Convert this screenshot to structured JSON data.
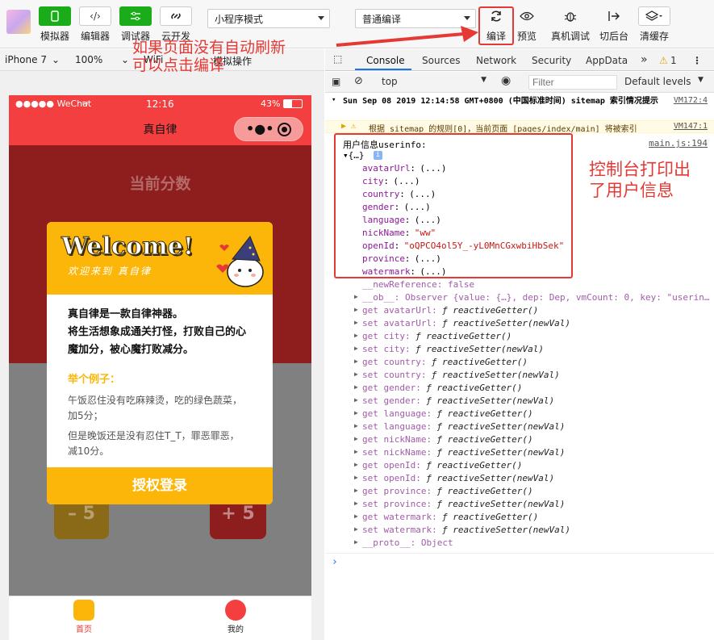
{
  "toolbar": {
    "buttons": [
      {
        "label": "模拟器",
        "icon": "phone-icon"
      },
      {
        "label": "编辑器",
        "icon": "code-icon"
      },
      {
        "label": "调试器",
        "icon": "sliders-icon"
      },
      {
        "label": "云开发",
        "icon": "cloud-link-icon"
      }
    ],
    "mode_select": "小程序模式",
    "compile_select": "普通编译",
    "right_buttons": [
      {
        "label": "编译",
        "icon": "refresh-icon"
      },
      {
        "label": "预览",
        "icon": "eye-icon"
      },
      {
        "label": "真机调试",
        "icon": "bug-icon"
      },
      {
        "label": "切后台",
        "icon": "exit-icon"
      },
      {
        "label": "清缓存",
        "icon": "layers-icon"
      }
    ]
  },
  "devbar": {
    "device": "iPhone 7",
    "zoom": "100%",
    "network": "WiFi",
    "action": "模拟操作"
  },
  "annotations": {
    "compile_hint_line1": "如果页面没有自动刷新",
    "compile_hint_line2": "可以点击编译",
    "console_hint_line1": "控制台打印出",
    "console_hint_line2": "了用户信息"
  },
  "phone": {
    "carrier": "●●●●● WeChat",
    "time": "12:16",
    "battery": "43%",
    "nav_title": "真自律",
    "score_title": "当前分数",
    "minus_label": "– 5",
    "plus_label": "+ 5",
    "tabs": [
      {
        "label": "首页"
      },
      {
        "label": "我的"
      }
    ],
    "modal": {
      "welcome": "Welcome!",
      "welcome_sub": "欢迎来到  真自律",
      "line1": "真自律是一款自律神器。",
      "line2": "将生活想象成通关打怪，打败自己的心魔加分，被心魔打败减分。",
      "example_title": "举个例子：",
      "example1": "午饭忍住没有吃麻辣烫，吃的绿色蔬菜，加5分；",
      "example2": "但是晚饭还是没有忍住T_T，罪恶罪恶，减10分。",
      "auth_button": "授权登录"
    }
  },
  "devtools": {
    "tabs": [
      "Console",
      "Sources",
      "Network",
      "Security",
      "AppData"
    ],
    "more": "»",
    "warn_count": "1",
    "context": "top",
    "filter_placeholder": "Filter",
    "levels": "Default levels",
    "log_header": "Sun Sep 08 2019 12:14:58 GMT+0800 (中国标准时间) sitemap 索引情况提示",
    "log_header_src": "VM172:4",
    "warning": "根据 sitemap 的规则[0]，当前页面 [pages/index/main] 将被索引",
    "warning_src": "VM147:1",
    "userinfo_label": "用户信息userinfo:",
    "userinfo_src": "main.js:194",
    "object_open": "▾{…}",
    "fields": [
      {
        "key": "avatarUrl",
        "value": "(...)"
      },
      {
        "key": "city",
        "value": "(...)"
      },
      {
        "key": "country",
        "value": "(...)"
      },
      {
        "key": "gender",
        "value": "(...)"
      },
      {
        "key": "language",
        "value": "(...)"
      },
      {
        "key": "nickName",
        "value": "\"ww\""
      },
      {
        "key": "openId",
        "value": "\"oQPCO4ol5Y_-yL0MnCGxwbiHbSek\""
      },
      {
        "key": "province",
        "value": "(...)"
      },
      {
        "key": "watermark",
        "value": "(...)"
      }
    ],
    "new_reference": "__newReference: false",
    "ob_line": "__ob__: Observer {value: {…}, dep: Dep, vmCount: 0, key: \"userin…",
    "accessors": [
      "get avatarUrl: ƒ reactiveGetter()",
      "set avatarUrl: ƒ reactiveSetter(newVal)",
      "get city: ƒ reactiveGetter()",
      "set city: ƒ reactiveSetter(newVal)",
      "get country: ƒ reactiveGetter()",
      "set country: ƒ reactiveSetter(newVal)",
      "get gender: ƒ reactiveGetter()",
      "set gender: ƒ reactiveSetter(newVal)",
      "get language: ƒ reactiveGetter()",
      "set language: ƒ reactiveSetter(newVal)",
      "get nickName: ƒ reactiveGetter()",
      "set nickName: ƒ reactiveSetter(newVal)",
      "get openId: ƒ reactiveGetter()",
      "set openId: ƒ reactiveSetter(newVal)",
      "get province: ƒ reactiveGetter()",
      "set province: ƒ reactiveSetter(newVal)",
      "get watermark: ƒ reactiveGetter()",
      "set watermark: ƒ reactiveSetter(newVal)"
    ],
    "proto": "__proto__: Object",
    "prompt": "›"
  },
  "colors": {
    "accent_red": "#e53935",
    "nav_red": "#f33f3f",
    "brand_yellow": "#fcb60a",
    "wechat_green": "#1aad19"
  }
}
